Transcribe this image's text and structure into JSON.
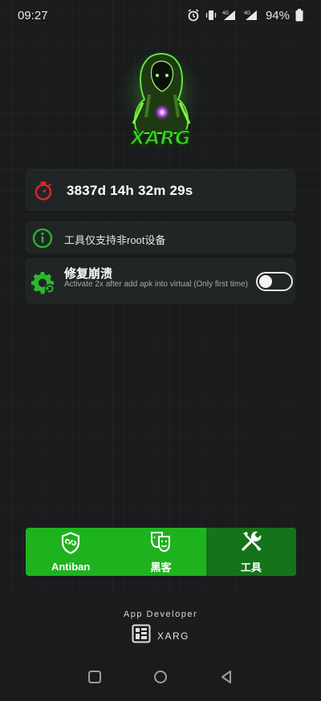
{
  "status_bar": {
    "time": "09:27",
    "battery": "94%",
    "net1": "4G",
    "net2": "4G"
  },
  "timer": {
    "value": "3837d 14h 32m 29s"
  },
  "info": {
    "text": "工具仅支持非root设备"
  },
  "fix_crash": {
    "title": "修复崩溃",
    "description": "Activate 2x after add apk into virtual (Only first time)",
    "toggle_on": false
  },
  "bottom_nav": {
    "items": [
      {
        "label": "Antiban",
        "icon": "shield-link-icon",
        "active": false
      },
      {
        "label": "黑客",
        "icon": "masks-icon",
        "active": false
      },
      {
        "label": "工具",
        "icon": "tools-icon",
        "active": true
      }
    ]
  },
  "developer": {
    "label": "App Developer",
    "name": "XARG"
  },
  "colors": {
    "accent_green": "#1fb21f",
    "active_tab": "#14741a",
    "timer_red": "#e0262b",
    "info_green": "#29b929"
  }
}
